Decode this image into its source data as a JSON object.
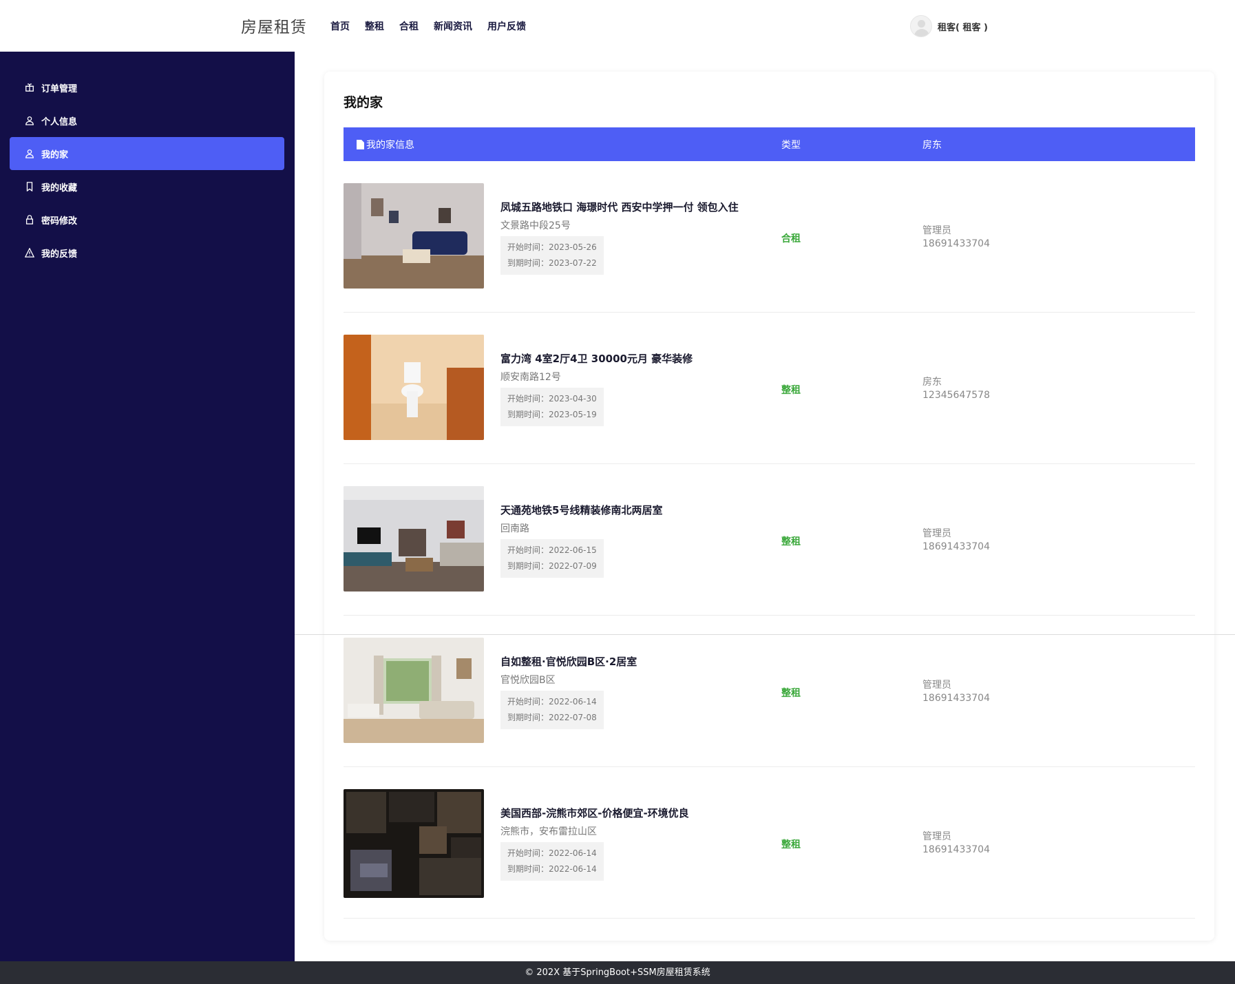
{
  "header": {
    "brand": "房屋租赁",
    "nav": [
      "首页",
      "整租",
      "合租",
      "新闻资讯",
      "用户反馈"
    ],
    "user": "租客( 租客 )"
  },
  "sidebar": {
    "items": [
      {
        "label": "订单管理",
        "icon": "gift-icon"
      },
      {
        "label": "个人信息",
        "icon": "user-icon"
      },
      {
        "label": "我的家",
        "icon": "user-icon",
        "active": true
      },
      {
        "label": "我的收藏",
        "icon": "bookmark-icon"
      },
      {
        "label": "密码修改",
        "icon": "lock-icon"
      },
      {
        "label": "我的反馈",
        "icon": "warning-icon"
      }
    ]
  },
  "main": {
    "title": "我的家",
    "columns": [
      "我的家信息",
      "类型",
      "房东"
    ],
    "rows": [
      {
        "title": "凤城五路地铁口 海璟时代 西安中学押一付 领包入住",
        "address": "文景路中段25号",
        "start": "开始时间：2023-05-26",
        "end": "到期时间：2023-07-22",
        "type": "合租",
        "owner_name": "管理员",
        "owner_phone": "18691433704"
      },
      {
        "title": "富力湾 4室2厅4卫 30000元月 豪华装修",
        "address": "顺安南路12号",
        "start": "开始时间：2023-04-30",
        "end": "到期时间：2023-05-19",
        "type": "整租",
        "owner_name": "房东",
        "owner_phone": "12345647578"
      },
      {
        "title": "天通苑地铁5号线精装修南北两居室",
        "address": "回南路",
        "start": "开始时间：2022-06-15",
        "end": "到期时间：2022-07-09",
        "type": "整租",
        "owner_name": "管理员",
        "owner_phone": "18691433704"
      },
      {
        "title": "自如整租·官悦欣园B区·2居室",
        "address": "官悦欣园B区",
        "start": "开始时间：2022-06-14",
        "end": "到期时间：2022-07-08",
        "type": "整租",
        "owner_name": "管理员",
        "owner_phone": "18691433704"
      },
      {
        "title": "美国西部-浣熊市郊区-价格便宜-环境优良",
        "address": "浣熊市，安布雷拉山区",
        "start": "开始时间：2022-06-14",
        "end": "到期时间：2022-06-14",
        "type": "整租",
        "owner_name": "管理员",
        "owner_phone": "18691433704"
      }
    ]
  },
  "footer": "© 202X 基于SpringBoot+SSM房屋租赁系统"
}
